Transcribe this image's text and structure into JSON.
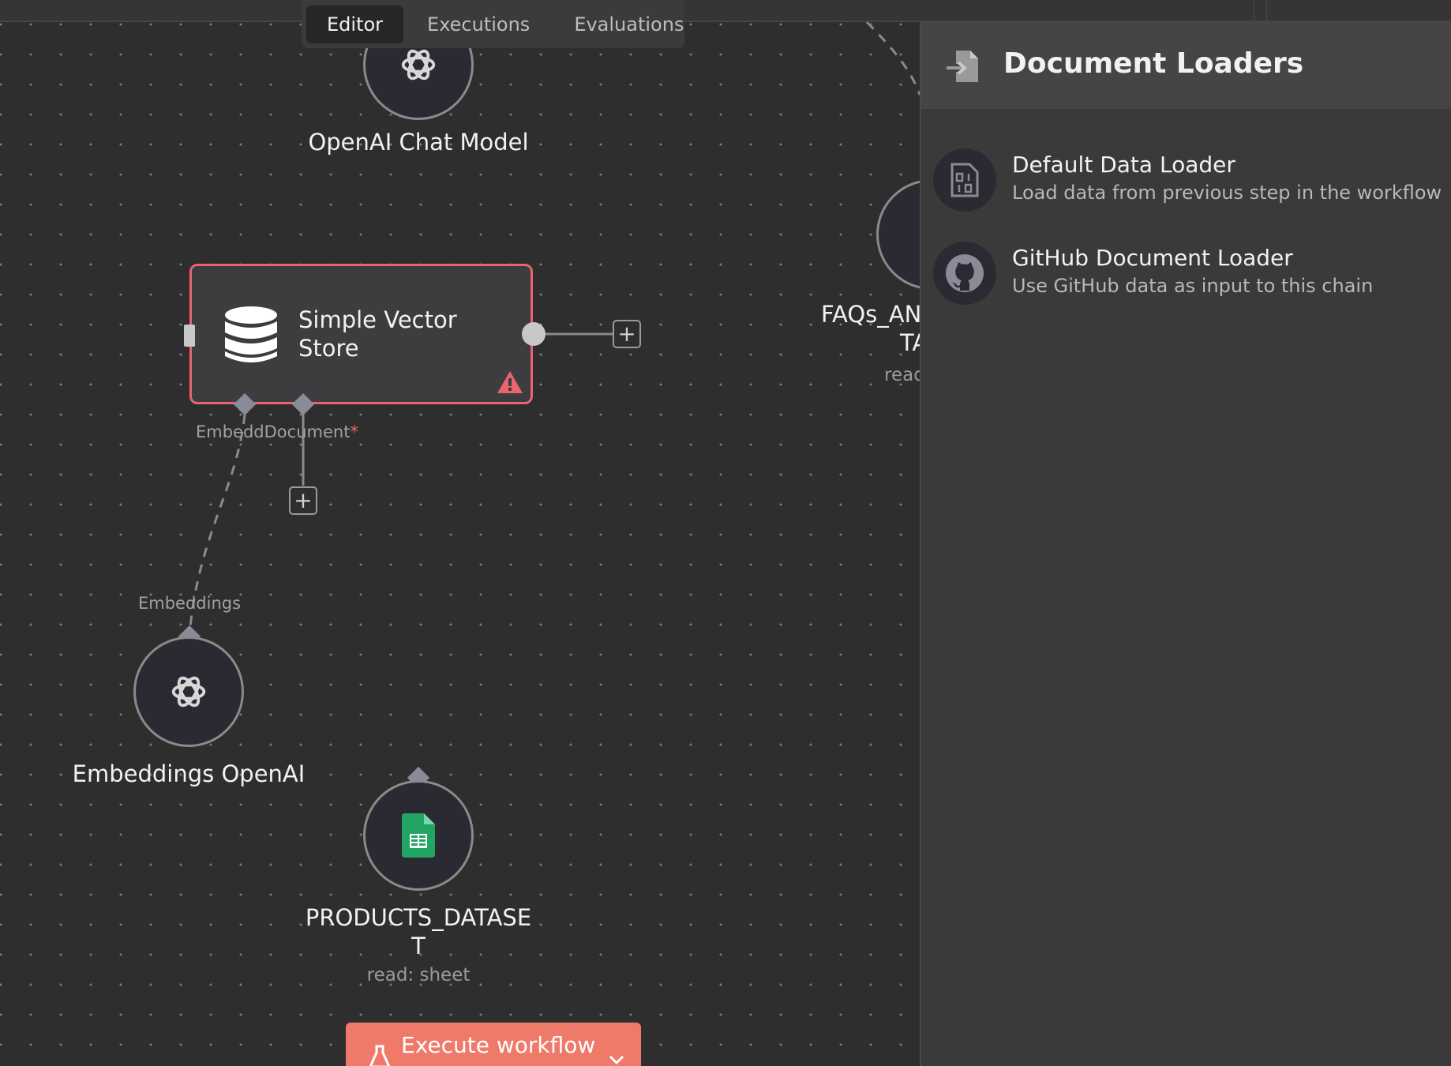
{
  "tabs": [
    {
      "label": "Editor",
      "active": true
    },
    {
      "label": "Executions",
      "active": false
    },
    {
      "label": "Evaluations",
      "active": false
    }
  ],
  "nodes": {
    "openai_chat_model": {
      "label": "OpenAI Chat Model",
      "icon": "openai-icon"
    },
    "simple_vector_store": {
      "label": "Simple Vector Store",
      "icon": "database-icon",
      "status": "warning"
    },
    "embeddings_openai": {
      "label": "Embeddings OpenAI",
      "icon": "openai-icon"
    },
    "products_dataset": {
      "label": "PRODUCTS_DATASET",
      "sublabel": "read: sheet",
      "icon": "google-sheets-icon"
    },
    "faqs": {
      "label": "FAQs_AN",
      "label_line2": "TA",
      "sublabel": "read"
    }
  },
  "handles": {
    "embedding": "Embedd",
    "document": "Document",
    "required_mark": "*",
    "embeddings": "Embeddings"
  },
  "execute_button": {
    "label": "Execute workflow"
  },
  "panel": {
    "title": "Document Loaders",
    "items": [
      {
        "title": "Default Data Loader",
        "description": "Load data from previous step in the workflow",
        "icon": "binary-file-icon"
      },
      {
        "title": "GitHub Document Loader",
        "description": "Use GitHub data as input to this chain",
        "icon": "github-icon"
      }
    ]
  },
  "colors": {
    "canvas_bg": "#2e2e2e",
    "error_border": "#e8646e",
    "execute_button": "#ef7a6a",
    "sheets_green": "#21a464",
    "panel_bg": "#3a3a3a"
  }
}
